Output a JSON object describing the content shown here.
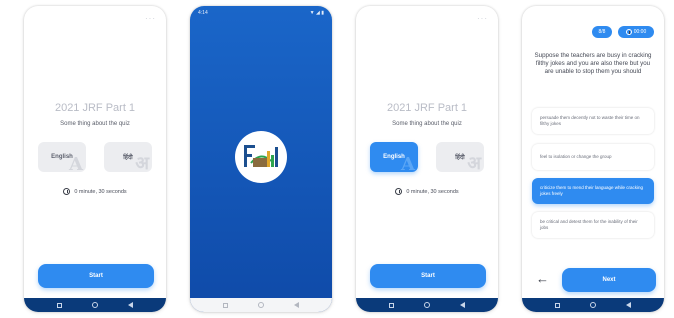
{
  "screens": [
    {
      "menu_icon": "more-dots-icon",
      "quiz_title": "2021 JRF Part 1",
      "quiz_subtitle": "Some thing about the quiz",
      "language_options": [
        {
          "label": "English",
          "ghost": "A",
          "selected": false
        },
        {
          "label": "हिंदी",
          "ghost": "अ",
          "selected": false
        }
      ],
      "timer_icon": "clock-icon",
      "timer_text": "0 minute, 30 seconds",
      "start_label": "Start"
    },
    {
      "status_time": "4:14",
      "status_right": "▼ ◢ ▮",
      "logo_icon": "fill-bold-logo"
    },
    {
      "menu_icon": "more-dots-icon",
      "quiz_title": "2021 JRF Part 1",
      "quiz_subtitle": "Some thing about the quiz",
      "language_options": [
        {
          "label": "English",
          "ghost": "A",
          "selected": true
        },
        {
          "label": "हिंदी",
          "ghost": "अ",
          "selected": false
        }
      ],
      "timer_icon": "clock-icon",
      "timer_text": "0 minute, 30 seconds",
      "start_label": "Start"
    },
    {
      "question_number": "8/8",
      "timer_pill": "00:00",
      "question": "Suppose the teachers are busy in cracking filthy jokes and you are also there but you are unable to stop them you should",
      "options": [
        {
          "text": "persuade them decently not to waste their time on filthy jokes",
          "selected": false
        },
        {
          "text": "feel to isolation or change the group",
          "selected": false
        },
        {
          "text": "criticize them to mend their language while cracking jokes freely",
          "selected": true
        },
        {
          "text": "be critical and detest them for the inability of their jobs",
          "selected": false
        }
      ],
      "back_icon": "back-arrow-icon",
      "next_label": "Next"
    }
  ],
  "colors": {
    "accent": "#2f8bf0",
    "splash_top": "#1a66c9",
    "splash_bottom": "#0f4aa8",
    "nav_bar": "#0a3a7a"
  }
}
